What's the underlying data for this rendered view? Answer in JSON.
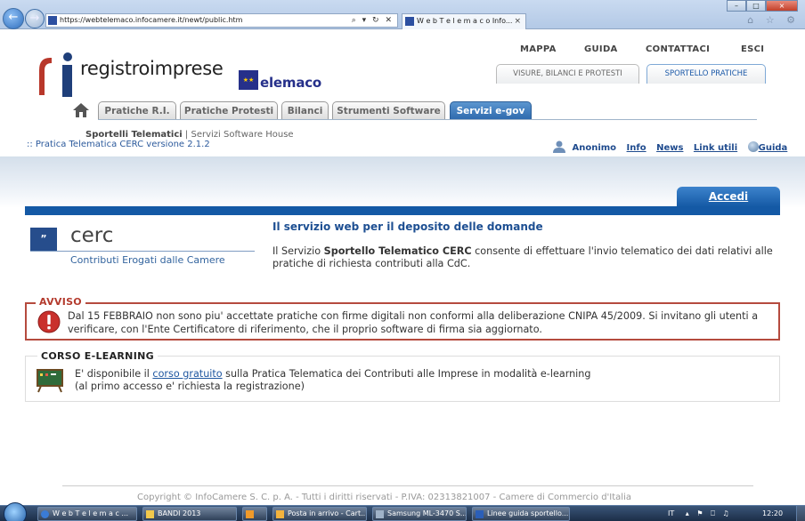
{
  "browser": {
    "url": "https://webtelemaco.infocamere.it/newt/public.htm",
    "url_controls": "⌕ ▾ ↻ ✕",
    "tab_title": "W e b T e l e m a c o Info...",
    "tab_close": "×",
    "back_glyph": "←",
    "forward_glyph": "→",
    "window_controls": [
      "–",
      "□",
      "×"
    ],
    "tool_icons": "⌂ ☆ ⚙"
  },
  "header": {
    "top_links": [
      "MAPPA",
      "GUIDA",
      "CONTATTACI",
      "ESCI"
    ],
    "sub_tabs": [
      "VISURE, BILANCI E PROTESTI",
      "SPORTELLO PRATICHE"
    ],
    "logo_text": "registroimprese",
    "telemaco_text": "elemaco",
    "telemaco_mark": "★★"
  },
  "main_tabs": [
    "Pratiche R.I.",
    "Pratiche Protesti",
    "Bilanci",
    "Strumenti Software",
    "Servizi e-gov"
  ],
  "breadcrumb": {
    "current": "Sportelli Telematici",
    "separator": "|",
    "rest": "Servizi Software House"
  },
  "version_text": ":: Pratica Telematica CERC versione 2.1.2",
  "userbar": {
    "user": "Anonimo",
    "links": [
      "Info",
      "News",
      "Link utili"
    ],
    "guida": "Guida"
  },
  "accedi_label": "Accedi",
  "service": {
    "logo_mark": "”",
    "logo_name": "cerc",
    "logo_subtitle": "Contributi Erogati dalle Camere",
    "title": "Il servizio web per il deposito delle domande",
    "desc_pre": "Il Servizio ",
    "desc_bold": "Sportello Telematico CERC",
    "desc_post": " consente di effettuare l'invio telematico dei dati relativi alle pratiche di richiesta contributi alla CdC."
  },
  "avviso": {
    "title": "AVVISO",
    "text": "Dal 15 FEBBRAIO non sono piu' accettate pratiche con firme digitali non conformi alla deliberazione CNIPA 45/2009. Si invitano gli utenti a verificare, con l'Ente Certificatore di riferimento, che il proprio software di firma sia aggiornato."
  },
  "corso": {
    "title": "CORSO E-LEARNING",
    "pre": "E' disponibile il ",
    "link": "corso gratuito",
    "post": " sulla Pratica Telematica dei Contributi alle Imprese in modalità e-learning",
    "line2": "(al primo accesso e' richiesta la registrazione)"
  },
  "footer": {
    "copyright": "Copyright © InfoCamere S. C. p. A. - Tutti i diritti riservati - P.IVA: 02313821007 - Camere di Commercio d'Italia"
  },
  "taskbar": {
    "items": [
      "W e b T e l e m a c ...",
      "BANDI 2013",
      "",
      "Posta in arrivo - Cart...",
      "Samsung ML-3470 S...",
      "Linee guida sportello..."
    ],
    "tray_lang": "IT",
    "tray_icons": "▴ ⚑ ⎕ ♫",
    "clock": "12:20"
  },
  "colors": {
    "brand_blue": "#1459a5",
    "avviso_red": "#b54b3e",
    "link_blue": "#1f4b8e"
  }
}
